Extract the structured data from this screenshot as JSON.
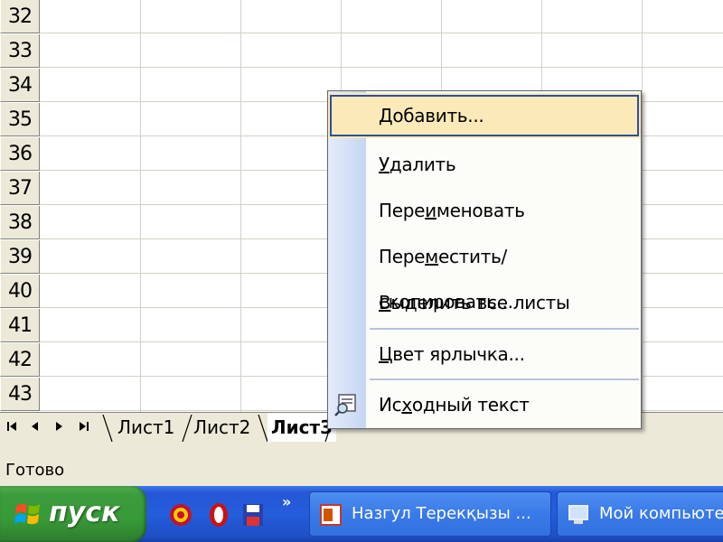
{
  "rows": [
    "32",
    "33",
    "34",
    "35",
    "36",
    "37",
    "38",
    "39",
    "40",
    "41",
    "42",
    "43"
  ],
  "sheet_tabs": {
    "nav": [
      "first-sheet",
      "prev-sheet",
      "next-sheet",
      "last-sheet"
    ],
    "tabs": [
      {
        "label": "Лист1",
        "active": false
      },
      {
        "label": "Лист2",
        "active": false
      },
      {
        "label": "Лист3",
        "active": true
      }
    ]
  },
  "status": {
    "text": "Готово"
  },
  "taskbar": {
    "start_label": "пуск",
    "quick_launch": [
      "browser-icon",
      "opera-icon",
      "save-icon"
    ],
    "quick_launch_more": "»",
    "tasks": [
      {
        "label": "Назгул Терекқызы ...",
        "icon": "powerpoint-icon"
      },
      {
        "label": "Мой компьютер",
        "icon": "computer-icon"
      }
    ]
  },
  "context_menu": {
    "items": [
      {
        "pre": "",
        "u": "Д",
        "post": "обавить...",
        "highlighted": true
      },
      {
        "pre": "",
        "u": "У",
        "post": "далить"
      },
      {
        "pre": "Пере",
        "u": "и",
        "post": "меновать"
      },
      {
        "pre": "Пере",
        "u": "м",
        "post": "естить/скопировать..."
      },
      {
        "pre": "",
        "u": "В",
        "post": "ыделить все листы"
      },
      {
        "pre": "",
        "u": "Ц",
        "post": "вет ярлычка..."
      },
      {
        "pre": "Ис",
        "u": "х",
        "post": "одный текст",
        "icon": "view-code-icon"
      }
    ]
  },
  "colors": {
    "menu_highlight": "#fbe9b7",
    "menu_highlight_border": "#2f4f9f",
    "taskbar": "#245ddb",
    "start_button": "#379a37",
    "chrome": "#ece9d8"
  }
}
